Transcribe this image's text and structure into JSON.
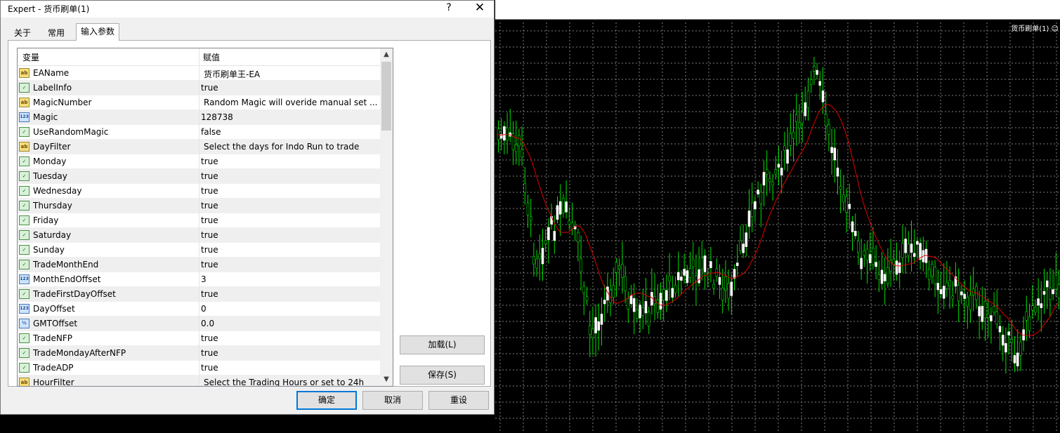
{
  "chart": {
    "label": "货币刷单(1) ☺"
  },
  "dialog": {
    "title": "Expert - 货币刷单(1)",
    "help_glyph": "?",
    "close_glyph": "✕",
    "tabs": [
      {
        "label": "关于",
        "active": false
      },
      {
        "label": "常用",
        "active": false
      },
      {
        "label": "输入参数",
        "active": true
      }
    ],
    "grid": {
      "col_variable": "变量",
      "col_value": "赋值",
      "rows": [
        {
          "type": "ab",
          "name": "EAName",
          "value": "货币刷单王-EA"
        },
        {
          "type": "bool",
          "name": "LabelInfo",
          "value": "true"
        },
        {
          "type": "ab",
          "name": "MagicNumber",
          "value": "Random Magic will overide manual set ..."
        },
        {
          "type": "num",
          "name": "Magic",
          "value": "128738"
        },
        {
          "type": "bool",
          "name": "UseRandomMagic",
          "value": "false"
        },
        {
          "type": "ab",
          "name": "DayFilter",
          "value": "Select the days for Indo Run to trade"
        },
        {
          "type": "bool",
          "name": "Monday",
          "value": "true"
        },
        {
          "type": "bool",
          "name": "Tuesday",
          "value": "true"
        },
        {
          "type": "bool",
          "name": "Wednesday",
          "value": "true"
        },
        {
          "type": "bool",
          "name": "Thursday",
          "value": "true"
        },
        {
          "type": "bool",
          "name": "Friday",
          "value": "true"
        },
        {
          "type": "bool",
          "name": "Saturday",
          "value": "true"
        },
        {
          "type": "bool",
          "name": "Sunday",
          "value": "true"
        },
        {
          "type": "bool",
          "name": "TradeMonthEnd",
          "value": "true"
        },
        {
          "type": "num",
          "name": "MonthEndOffset",
          "value": "3"
        },
        {
          "type": "bool",
          "name": "TradeFirstDayOffset",
          "value": "true"
        },
        {
          "type": "num",
          "name": "DayOffset",
          "value": "0"
        },
        {
          "type": "dbl",
          "name": "GMTOffset",
          "value": "0.0"
        },
        {
          "type": "bool",
          "name": "TradeNFP",
          "value": "true"
        },
        {
          "type": "bool",
          "name": "TradeMondayAfterNFP",
          "value": "true"
        },
        {
          "type": "bool",
          "name": "TradeADP",
          "value": "true"
        },
        {
          "type": "ab",
          "name": "HourFilter",
          "value": "Select the Trading Hours or set to 24h"
        }
      ]
    },
    "scroll_up_glyph": "▲",
    "scroll_down_glyph": "▼",
    "buttons": {
      "load": "加载(L)",
      "save": "保存(S)",
      "ok": "确定",
      "cancel": "取消",
      "reset": "重设"
    },
    "icon_glyphs": {
      "ab": "ab",
      "bool": "✓",
      "num": "123",
      "dbl": "½"
    }
  }
}
